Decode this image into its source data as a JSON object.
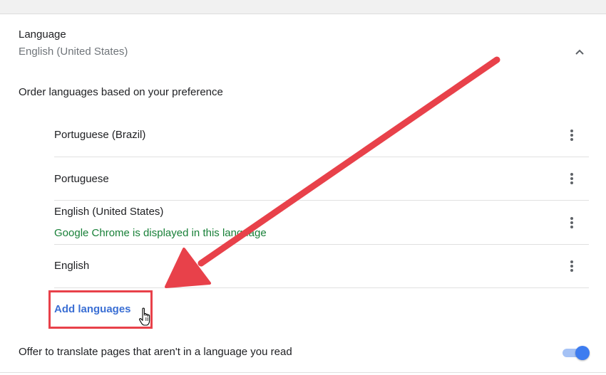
{
  "language_section": {
    "title": "Language",
    "current_value": "English (United States)",
    "collapse_icon": "chevron-up-icon"
  },
  "order_label": "Order languages based on your preference",
  "languages": [
    {
      "name": "Portuguese (Brazil)",
      "note": ""
    },
    {
      "name": "Portuguese",
      "note": ""
    },
    {
      "name": "English (United States)",
      "note": "Google Chrome is displayed in this language"
    },
    {
      "name": "English",
      "note": ""
    }
  ],
  "more_actions_icon": "more-vert-icon",
  "add_languages_label": "Add languages",
  "translate": {
    "label": "Offer to translate pages that aren't in a language you read",
    "enabled": true
  },
  "colors": {
    "annotation": "#e8414a",
    "link": "#3b6fd4",
    "note": "#188038",
    "toggle_on": "#3d7cf0"
  }
}
